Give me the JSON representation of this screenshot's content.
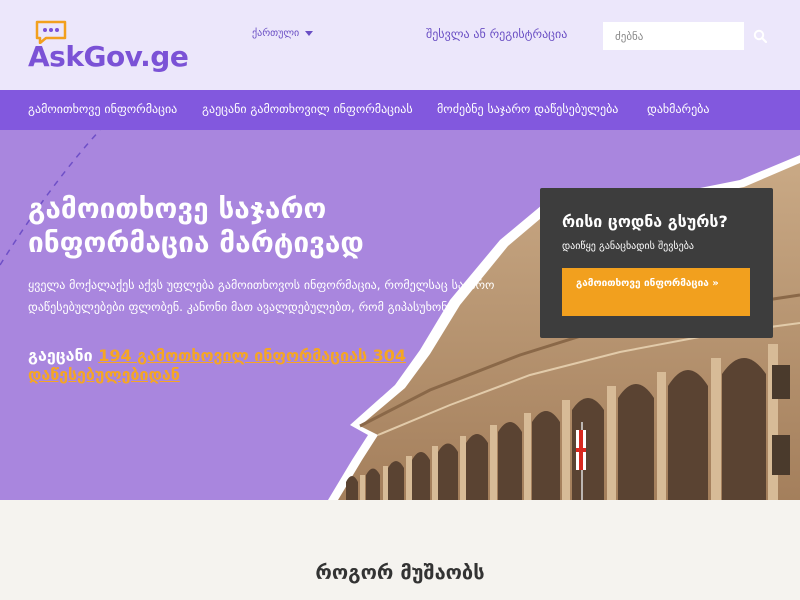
{
  "header": {
    "logo_text": "AskGov.ge",
    "language": "ქართული",
    "login": "შესვლა ან რეგისტრაცია",
    "search_placeholder": "ძებნა"
  },
  "nav": {
    "items": [
      {
        "label": "გამოითხოვე ინფორმაცია"
      },
      {
        "label": "გაეცანი გამოთხოვილ ინფორმაციას"
      },
      {
        "label": "მოძებნე საჯარო დაწესებულება"
      },
      {
        "label": "დახმარება"
      }
    ]
  },
  "hero": {
    "title": "გამოითხოვე საჯარო ინფორმაცია მარტივად",
    "description": "ყველა მოქალაქეს აქვს უფლება გამოითხოვოს ინფორმაცია, რომელსაც საჯარო დაწესებულებები ფლობენ. კანონი მათ ავალდებულებთ, რომ გიპასუხონ.",
    "stats_prefix": "გაეცანი ",
    "stats_link": "194 გამოთხოვილ ინფორმაციას 304 დაწესებულებიდან"
  },
  "cta": {
    "title": "რისი ცოდნა გსურს?",
    "subtitle": "დაიწყე განაცხადის შევსება",
    "button": "გამოითხოვე ინფორმაცია »"
  },
  "how": {
    "title": "როგორ მუშაობს"
  },
  "colors": {
    "brand_purple": "#7b52d6",
    "nav_purple": "#8258de",
    "hero_lavender": "#a986de",
    "accent_orange": "#f2a01e",
    "cta_dark": "#3d3d3d"
  },
  "icons": [
    "speech-bubble-logo-icon",
    "chevron-down-icon",
    "search-icon"
  ]
}
